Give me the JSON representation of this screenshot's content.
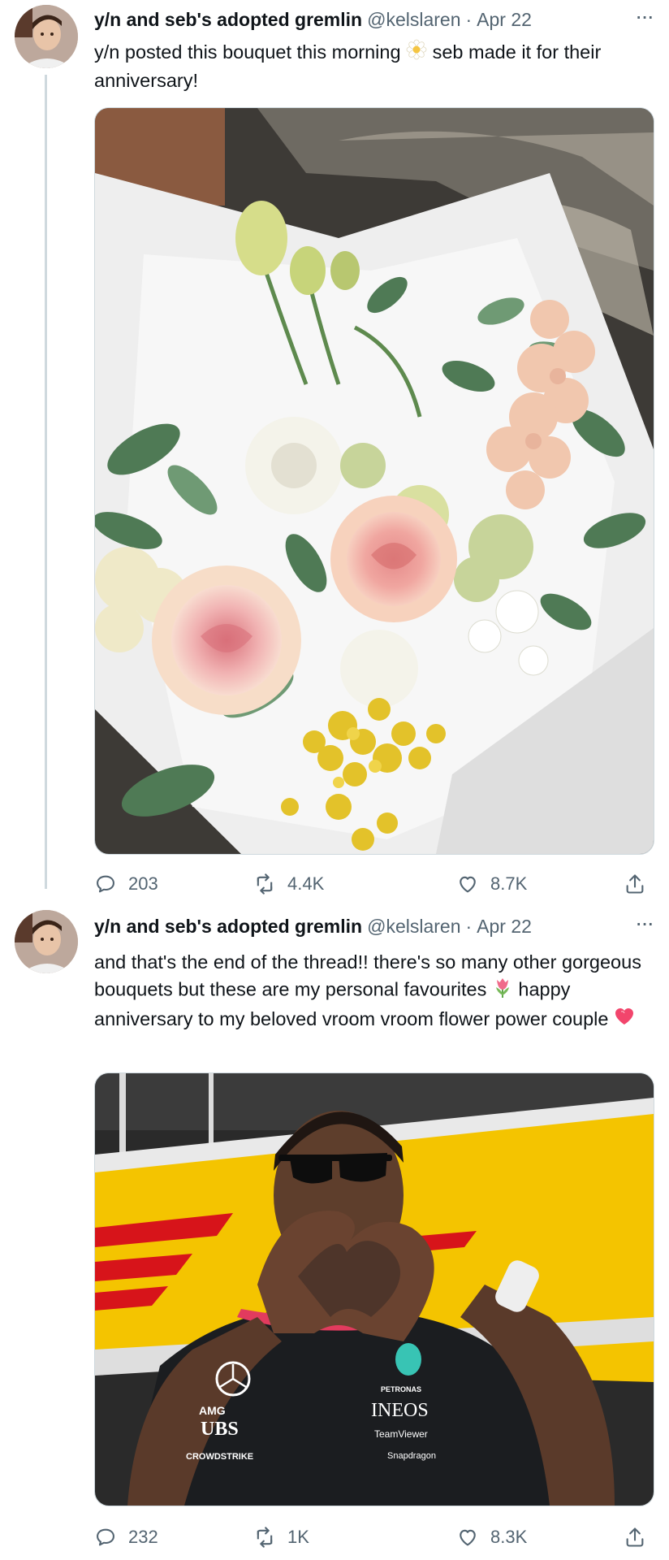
{
  "tweets": [
    {
      "display_name": "y/n and seb's adopted gremlin",
      "handle": "@kelslaren",
      "separator": "·",
      "date": "Apr 22",
      "more": "···",
      "text_part1": "y/n posted this bouquet this morning ",
      "emoji1": "flower-emoji",
      "text_part2": " seb made it for their anniversary!",
      "media_description_icon": "bouquet-photo",
      "replies": "203",
      "retweets": "4.4K",
      "likes": "8.7K"
    },
    {
      "display_name": "y/n and seb's adopted gremlin",
      "handle": "@kelslaren",
      "separator": "·",
      "date": "Apr 22",
      "more": "···",
      "text_part1": "and that's the end of the thread!! there's so many other gorgeous bouquets but these are my personal favourites ",
      "emoji1": "tulip-emoji",
      "text_part2": " happy anniversary to my beloved vroom vroom flower power couple ",
      "emoji2": "heart-emoji",
      "replies": "232",
      "retweets": "1K",
      "likes": "8.3K",
      "shirt_text": {
        "brand1": "UBS",
        "brand2": "INEOS",
        "brand3": "PETRONAS",
        "brand4": "TeamViewer",
        "brand5": "Snapdragon",
        "brand6": "CROWDSTRIKE",
        "brand7": "AMG"
      }
    }
  ],
  "colors": {
    "text": "#0f1419",
    "secondary": "#536471",
    "border": "#cfd9de"
  }
}
